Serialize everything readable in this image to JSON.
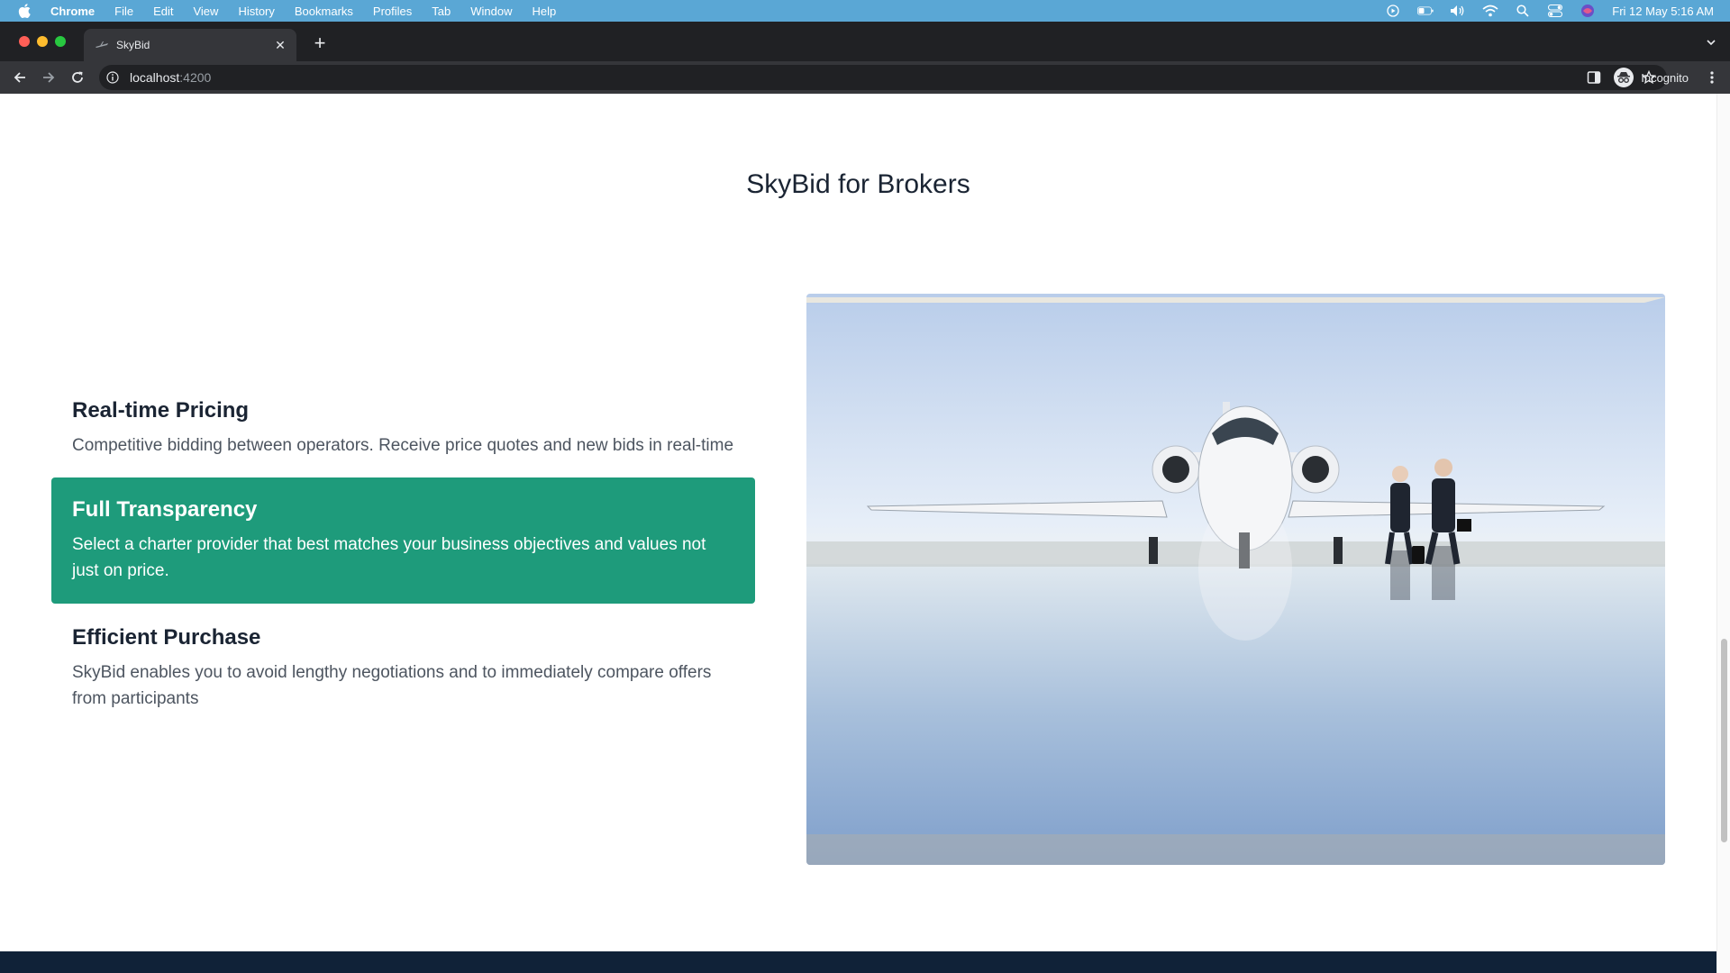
{
  "menubar": {
    "app": "Chrome",
    "items": [
      "File",
      "Edit",
      "View",
      "History",
      "Bookmarks",
      "Profiles",
      "Tab",
      "Window",
      "Help"
    ],
    "clock": "Fri 12 May  5:16 AM"
  },
  "browser": {
    "tab_title": "SkyBid",
    "url_host": "localhost",
    "url_port": ":4200",
    "profile_label": "Incognito"
  },
  "page": {
    "title": "SkyBid for Brokers",
    "features": [
      {
        "title": "Real-time Pricing",
        "text": "Competitive bidding between operators. Receive price quotes and new bids in real-time",
        "active": false
      },
      {
        "title": "Full Transparency",
        "text": "Select a charter provider that best matches your business objectives and values not just on price.",
        "active": true
      },
      {
        "title": "Efficient Purchase",
        "text": "SkyBid enables you to avoid lengthy negotiations and to immediately compare offers from participants",
        "active": false
      }
    ]
  },
  "colors": {
    "accent": "#1e9b7b",
    "heading": "#1a2433",
    "footer": "#102238"
  }
}
